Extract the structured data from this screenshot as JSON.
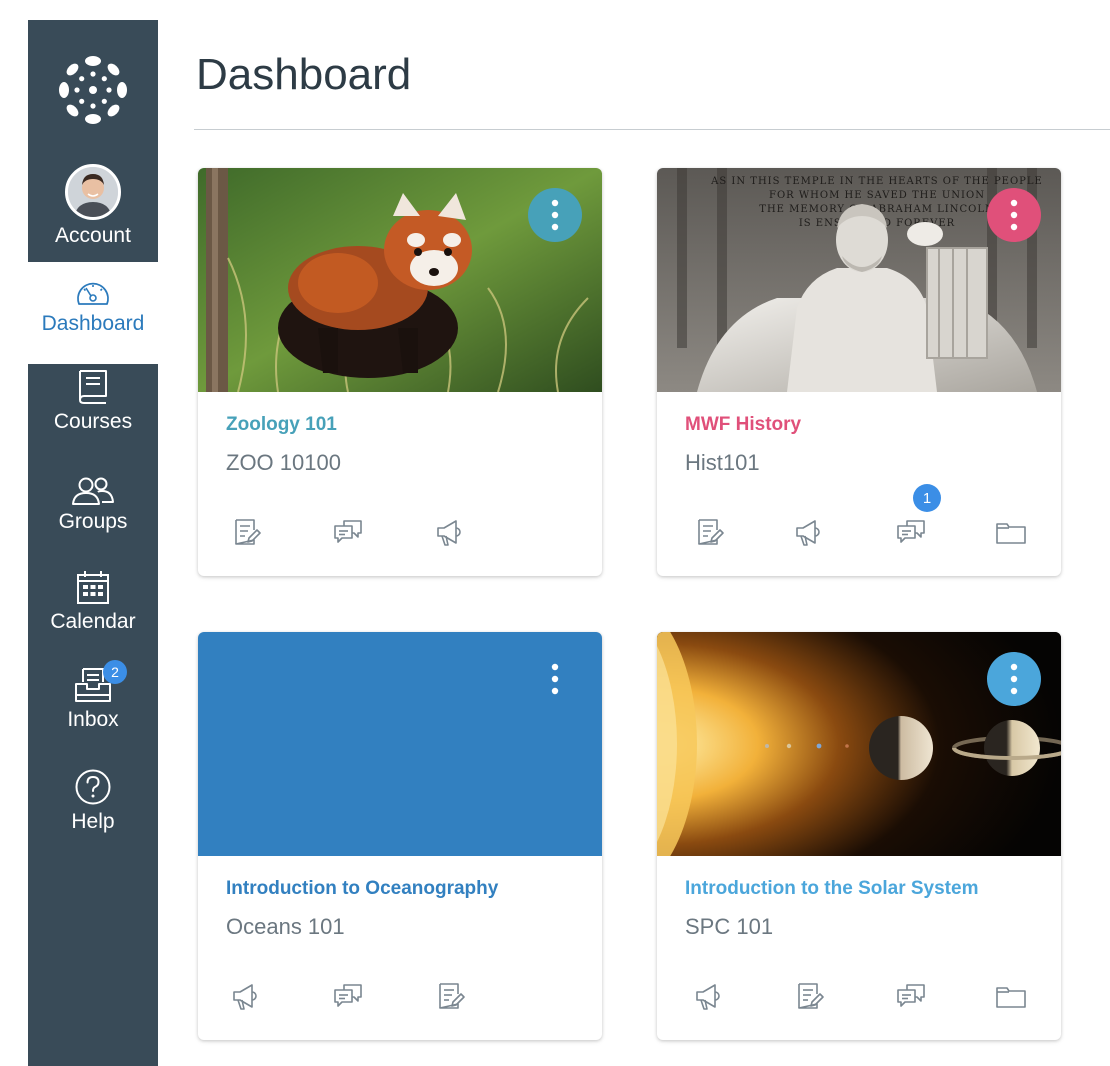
{
  "nav": {
    "account_label": "Account",
    "dashboard_label": "Dashboard",
    "courses_label": "Courses",
    "groups_label": "Groups",
    "calendar_label": "Calendar",
    "inbox_label": "Inbox",
    "inbox_badge": "2",
    "help_label": "Help",
    "icons": [
      "canvas-logo-icon",
      "avatar",
      "dashboard-icon",
      "courses-icon",
      "groups-icon",
      "calendar-icon",
      "inbox-icon",
      "help-icon"
    ]
  },
  "header": {
    "title": "Dashboard"
  },
  "colors": {
    "nav_bg": "#394b58",
    "nav_active": "#2b7abc",
    "zoology": "#47a1b9",
    "history": "#e0507a",
    "oceanography": "#3280c0",
    "solar": "#4ba6db",
    "badge": "#3b8ee6"
  },
  "cards": [
    {
      "title": "Zoology 101",
      "code": "ZOO 10100",
      "color": "#47a1b9",
      "hero": "red-panda-photo",
      "actions": [
        "assignments-icon",
        "discussions-icon",
        "announcements-icon"
      ]
    },
    {
      "title": "MWF History",
      "code": "Hist101",
      "color": "#e0507a",
      "hero": "lincoln-memorial-photo",
      "hero_caption": "AS IN THIS TEMPLE IN THE HEARTS OF THE PEOPLE FOR WHOM HE SAVED THE UNION THE MEMORY OF ABRAHAM LINCOLN IS ENSHRINED FOREVER",
      "actions": [
        "assignments-icon",
        "announcements-icon",
        "discussions-icon",
        "files-icon"
      ],
      "discussions_badge": "1"
    },
    {
      "title": "Introduction to Oceanography",
      "code": "Oceans 101",
      "color": "#3280c0",
      "hero": "solid-color",
      "actions": [
        "announcements-icon",
        "discussions-icon",
        "assignments-icon"
      ]
    },
    {
      "title": "Introduction to the Solar System",
      "code": "SPC 101",
      "color": "#4ba6db",
      "hero": "solar-system-photo",
      "actions": [
        "announcements-icon",
        "assignments-icon",
        "discussions-icon",
        "files-icon"
      ]
    }
  ]
}
